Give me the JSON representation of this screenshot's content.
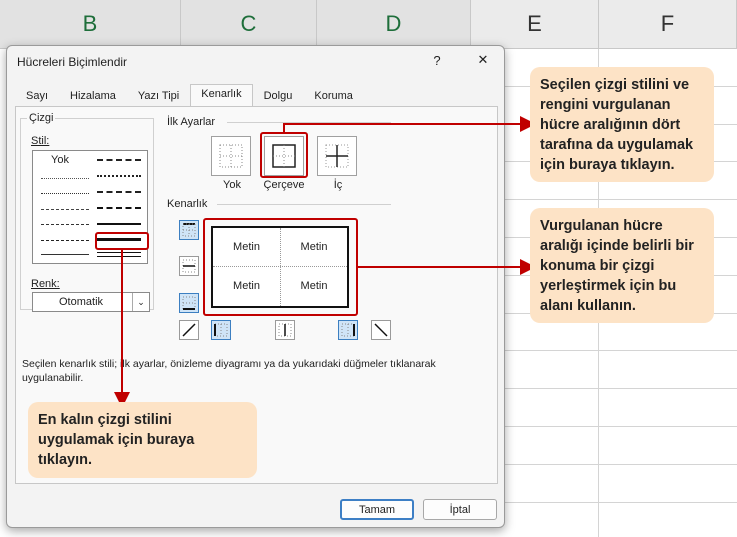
{
  "sheet": {
    "columns": [
      "B",
      "C",
      "D",
      "E",
      "F"
    ]
  },
  "dialog": {
    "title": "Hücreleri Biçimlendir",
    "help_label": "?",
    "close_label": "✕",
    "tabs": [
      "Sayı",
      "Hizalama",
      "Yazı Tipi",
      "Kenarlık",
      "Dolgu",
      "Koruma"
    ],
    "active_tab": "Kenarlık",
    "line_group_label": "Çizgi",
    "style_label": "Stil:",
    "none_style_label": "Yok",
    "color_label": "Renk:",
    "color_value": "Otomatik",
    "presets_label": "İlk Ayarlar",
    "presets": [
      "Yok",
      "Çerçeve",
      "İç"
    ],
    "border_label": "Kenarlık",
    "preview_cells": [
      "Metin",
      "Metin",
      "Metin",
      "Metin"
    ],
    "hint": "Seçilen kenarlık stili; ilk ayarlar, önizleme diyagramı ya da yukarıdaki düğmeler tıklanarak uygulanabilir.",
    "ok_label": "Tamam",
    "cancel_label": "İptal"
  },
  "callouts": {
    "outline": "Seçilen çizgi stilini ve rengini vurgulanan hücre aralığının dört tarafına da uygulamak için buraya tıklayın.",
    "border_area": "Vurgulanan hücre aralığı içinde belirli bir konuma bir çizgi yerleştirmek için bu alanı kullanın.",
    "thickest": "En kalın çizgi stilini uygulamak için buraya tıklayın."
  },
  "colors": {
    "accent_red": "#c00000",
    "callout_bg": "#fde3c6",
    "selected_blue": "#3d7fc5"
  }
}
